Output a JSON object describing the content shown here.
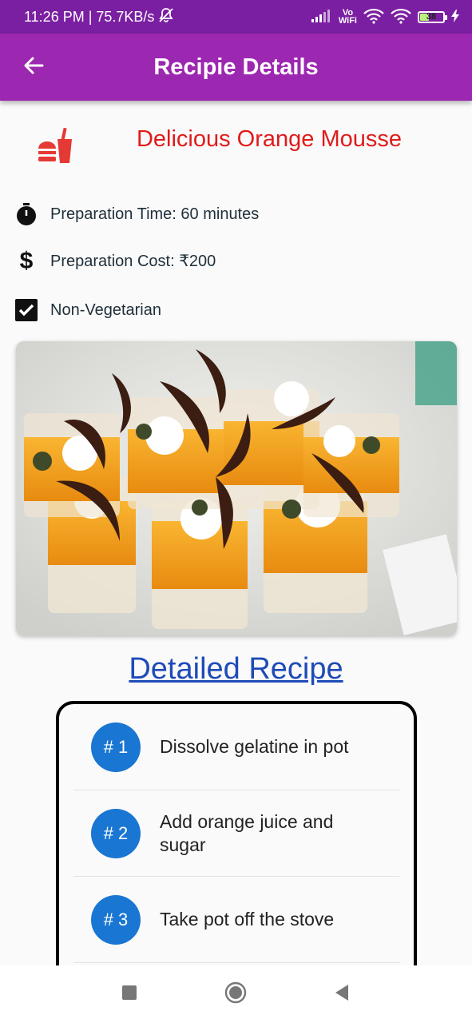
{
  "status_bar": {
    "time_speed": "11:26 PM | 75.7KB/s",
    "vowifi_top": "Vo",
    "vowifi_bottom": "WiFi",
    "battery_level": "38",
    "battery_fraction": 0.38
  },
  "app_bar": {
    "title": "Recipie Details",
    "back_icon": "arrow-left-icon"
  },
  "recipe": {
    "name": "Delicious Orange Mousse",
    "icon": "fastfood-icon",
    "prep_time": "Preparation Time: 60 minutes",
    "prep_cost": "Preparation Cost: ₹200",
    "diet": "Non-Vegetarian",
    "diet_checked": true
  },
  "detailed_link": "Detailed Recipe",
  "steps": [
    {
      "badge": "# 1",
      "text": "Dissolve gelatine in pot"
    },
    {
      "badge": "# 2",
      "text": "Add orange juice and sugar"
    },
    {
      "badge": "# 3",
      "text": "Take pot off the stove"
    }
  ],
  "colors": {
    "status_bar": "#7b1fa2",
    "app_bar": "#9c27b0",
    "title_red": "#e01b1b",
    "link_blue": "#1f4bb8",
    "step_badge": "#1976d2"
  }
}
